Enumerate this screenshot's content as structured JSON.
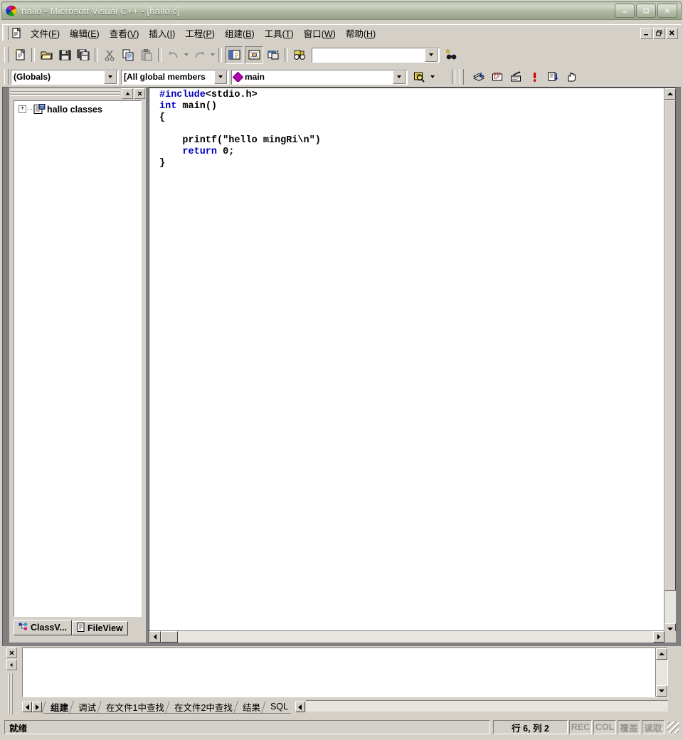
{
  "window": {
    "title": "hallo - Microsoft Visual C++ - [hallo.c]",
    "app_icon": "vcpp-icon",
    "minimize_label": "–",
    "maximize_label": "□",
    "close_label": "✕"
  },
  "mdi": {
    "doc_icon": "document-icon",
    "restore_label": "–",
    "min_label": "❐",
    "close_label": "✕"
  },
  "menu": {
    "items": [
      {
        "label": "文件",
        "accel": "F"
      },
      {
        "label": "编辑",
        "accel": "E"
      },
      {
        "label": "查看",
        "accel": "V"
      },
      {
        "label": "插入",
        "accel": "I"
      },
      {
        "label": "工程",
        "accel": "P"
      },
      {
        "label": "组建",
        "accel": "B"
      },
      {
        "label": "工具",
        "accel": "T"
      },
      {
        "label": "窗口",
        "accel": "W"
      },
      {
        "label": "帮助",
        "accel": "H"
      }
    ]
  },
  "toolbar_standard": {
    "buttons": [
      {
        "name": "new-text-file-button",
        "icon": "new-file-icon"
      },
      {
        "name": "open-button",
        "icon": "open-folder-icon"
      },
      {
        "name": "save-button",
        "icon": "floppy-save-icon"
      },
      {
        "name": "save-all-button",
        "icon": "save-all-icon"
      },
      {
        "name": "cut-button",
        "icon": "scissors-icon"
      },
      {
        "name": "copy-button",
        "icon": "copy-icon"
      },
      {
        "name": "paste-button",
        "icon": "paste-icon"
      },
      {
        "name": "undo-button",
        "icon": "undo-arrow-icon"
      },
      {
        "name": "redo-button",
        "icon": "redo-arrow-icon"
      },
      {
        "name": "workspace-toggle-button",
        "icon": "workspace-panel-icon"
      },
      {
        "name": "output-toggle-button",
        "icon": "output-panel-icon"
      },
      {
        "name": "window-list-button",
        "icon": "window-list-icon"
      },
      {
        "name": "find-in-files-button",
        "icon": "binoculars-icon"
      }
    ],
    "search": {
      "value": "",
      "placeholder": ""
    }
  },
  "toolbar_wizard": {
    "class_combo": {
      "value": "(Globals)",
      "icon": "chevron-down-icon"
    },
    "members_combo": {
      "value": "[All global members",
      "icon": "chevron-down-icon"
    },
    "function_combo": {
      "value": "main",
      "icon": "member-diamond-icon"
    },
    "wizardbar_action": {
      "name": "wizardbar-action-button",
      "icon": "wizard-magnifier-icon"
    },
    "build_buttons": [
      {
        "name": "compile-button",
        "icon": "compile-icon"
      },
      {
        "name": "build-button",
        "icon": "build-bricks-icon"
      },
      {
        "name": "stop-build-button",
        "icon": "stop-build-icon"
      },
      {
        "name": "execute-program-button",
        "icon": "exclamation-run-icon"
      },
      {
        "name": "go-debug-button",
        "icon": "step-into-icon"
      },
      {
        "name": "insert-breakpoint-button",
        "icon": "hand-breakpoint-icon"
      }
    ]
  },
  "workspace": {
    "caption_buttons": [
      {
        "name": "workspace-collapse-button",
        "icon": "triangle-up-icon",
        "label": "▲"
      },
      {
        "name": "workspace-close-button",
        "icon": "close-icon",
        "label": "✕"
      }
    ],
    "tree": [
      {
        "label": "hallo classes",
        "expander": "+",
        "icon": "class-folder-icon"
      }
    ],
    "tabs": [
      {
        "label": "ClassV...",
        "icon": "classview-icon",
        "active": true
      },
      {
        "label": "FileView",
        "icon": "fileview-icon",
        "active": false
      }
    ]
  },
  "editor": {
    "filename": "hallo.c",
    "lines": [
      [
        {
          "t": "#include",
          "k": true
        },
        {
          "t": "<stdio.h>",
          "k": false
        }
      ],
      [
        {
          "t": "int",
          "k": true
        },
        {
          "t": " main()",
          "k": false
        }
      ],
      [
        {
          "t": "{",
          "k": false
        }
      ],
      [
        {
          "t": "    printf(\"hello mingRi\\n\")",
          "k": false
        }
      ],
      [
        {
          "t": "    ",
          "k": false
        },
        {
          "t": "return",
          "k": true
        },
        {
          "t": " 0;",
          "k": false
        }
      ],
      [
        {
          "t": "}",
          "k": false
        }
      ]
    ],
    "keyword_color": "#0000c0",
    "text_color": "#000000"
  },
  "output": {
    "text": "",
    "close_label": "✕",
    "nav_prev": "◀",
    "nav_next": "▶",
    "tabs": [
      {
        "label": "组建",
        "active": true
      },
      {
        "label": "调试",
        "active": false
      },
      {
        "label": "在文件1中查找",
        "active": false
      },
      {
        "label": "在文件2中查找",
        "active": false
      },
      {
        "label": "结果",
        "active": false
      },
      {
        "label": "SQL",
        "active": false
      }
    ]
  },
  "statusbar": {
    "message": "就绪",
    "position": "行 6, 列 2",
    "indicators": [
      "REC",
      "COL",
      "覆盖",
      "读取"
    ]
  }
}
